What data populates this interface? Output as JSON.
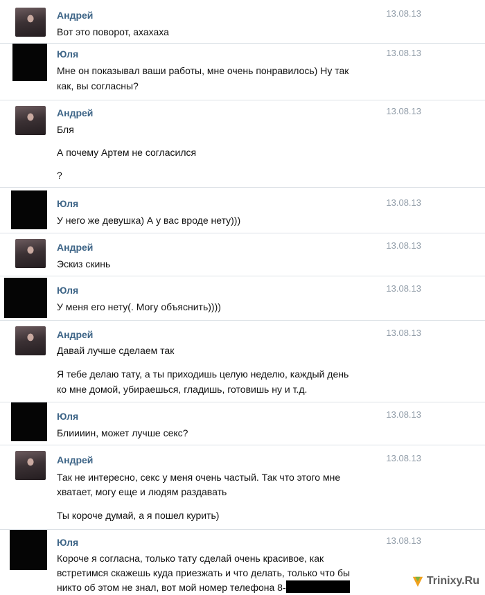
{
  "messages": [
    {
      "author": "Андрей",
      "date": "13.08.13",
      "lines": [
        "Вот это поворот, ахахаха"
      ]
    },
    {
      "author": "Юля",
      "date": "13.08.13",
      "lines": [
        "Мне он показывал ваши работы, мне очень понравилось) Ну так",
        "как, вы согласны?"
      ]
    },
    {
      "author": "Андрей",
      "date": "13.08.13",
      "lines": [
        "Бля",
        "А почему Артем не согласился",
        "?"
      ]
    },
    {
      "author": "Юля",
      "date": "13.08.13",
      "lines": [
        "У него же девушка) А у вас вроде нету)))"
      ]
    },
    {
      "author": "Андрей",
      "date": "13.08.13",
      "lines": [
        "Эскиз скинь"
      ]
    },
    {
      "author": "Юля",
      "date": "13.08.13",
      "lines": [
        "У меня его нету(. Могу объяснить))))"
      ]
    },
    {
      "author": "Андрей",
      "date": "13.08.13",
      "lines": [
        "Давай лучше сделаем так",
        "Я тебе делаю тату, а ты приходишь целую неделю, каждый день",
        "ко мне домой, убираешься, гладишь, готовишь ну и т.д."
      ]
    },
    {
      "author": "Юля",
      "date": "13.08.13",
      "lines": [
        "Блиииин, может лучше секс?"
      ]
    },
    {
      "author": "Андрей",
      "date": "13.08.13",
      "lines": [
        "Так не интересно, секс у меня очень частый. Так что этого мне",
        "хватает, могу еще и людям раздавать",
        "Ты короче думай, а я пошел курить)"
      ]
    },
    {
      "author": "Юля",
      "date": "13.08.13",
      "lines": [
        "Короче я согласна, только тату сделай очень красивое, как",
        "встретимся скажешь куда приезжать и что делать, только что бы",
        "никто об этом не знал, вот мой номер телефона 8-"
      ]
    }
  ],
  "watermark": {
    "text": "Trinixy.Ru"
  }
}
